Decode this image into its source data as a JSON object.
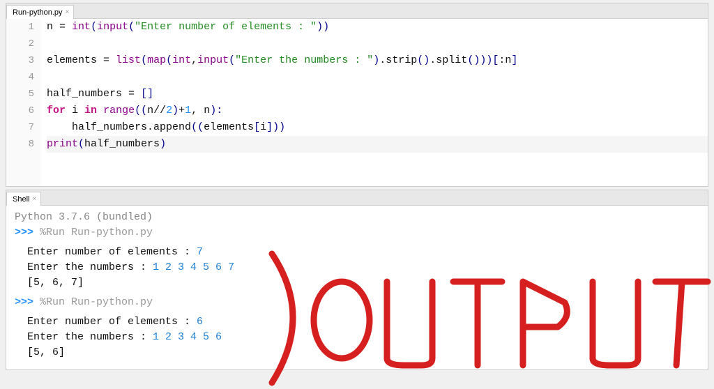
{
  "editor": {
    "tab": {
      "filename": "Run-python.py",
      "close": "×"
    },
    "lines": [
      {
        "n": 1,
        "tokens": [
          {
            "t": "n ",
            "c": "c-name"
          },
          {
            "t": "=",
            "c": "c-op"
          },
          {
            "t": " ",
            "c": ""
          },
          {
            "t": "int",
            "c": "c-builtin"
          },
          {
            "t": "(",
            "c": "c-paren"
          },
          {
            "t": "input",
            "c": "c-builtin"
          },
          {
            "t": "(",
            "c": "c-paren"
          },
          {
            "t": "\"Enter number of elements : \"",
            "c": "c-string"
          },
          {
            "t": "))",
            "c": "c-paren"
          }
        ]
      },
      {
        "n": 2,
        "tokens": []
      },
      {
        "n": 3,
        "tokens": [
          {
            "t": "elements ",
            "c": "c-name"
          },
          {
            "t": "=",
            "c": "c-op"
          },
          {
            "t": " ",
            "c": ""
          },
          {
            "t": "list",
            "c": "c-builtin"
          },
          {
            "t": "(",
            "c": "c-paren"
          },
          {
            "t": "map",
            "c": "c-builtin"
          },
          {
            "t": "(",
            "c": "c-paren"
          },
          {
            "t": "int",
            "c": "c-builtin"
          },
          {
            "t": ",",
            "c": "c-op"
          },
          {
            "t": "input",
            "c": "c-builtin"
          },
          {
            "t": "(",
            "c": "c-paren"
          },
          {
            "t": "\"Enter the numbers : \"",
            "c": "c-string"
          },
          {
            "t": ")",
            "c": "c-paren"
          },
          {
            "t": ".",
            "c": "c-op"
          },
          {
            "t": "strip",
            "c": "c-name"
          },
          {
            "t": "()",
            "c": "c-paren"
          },
          {
            "t": ".",
            "c": "c-op"
          },
          {
            "t": "split",
            "c": "c-name"
          },
          {
            "t": "()))[",
            "c": "c-paren"
          },
          {
            "t": ":",
            "c": "c-op"
          },
          {
            "t": "n",
            "c": "c-name"
          },
          {
            "t": "]",
            "c": "c-paren"
          }
        ]
      },
      {
        "n": 4,
        "tokens": []
      },
      {
        "n": 5,
        "tokens": [
          {
            "t": "half_numbers ",
            "c": "c-name"
          },
          {
            "t": "=",
            "c": "c-op"
          },
          {
            "t": " ",
            "c": ""
          },
          {
            "t": "[]",
            "c": "c-paren"
          }
        ]
      },
      {
        "n": 6,
        "tokens": [
          {
            "t": "for",
            "c": "c-keyword"
          },
          {
            "t": " i ",
            "c": "c-name"
          },
          {
            "t": "in",
            "c": "c-keyword"
          },
          {
            "t": " ",
            "c": ""
          },
          {
            "t": "range",
            "c": "c-builtin"
          },
          {
            "t": "((",
            "c": "c-paren"
          },
          {
            "t": "n",
            "c": "c-name"
          },
          {
            "t": "//",
            "c": "c-op"
          },
          {
            "t": "2",
            "c": "c-number"
          },
          {
            "t": ")",
            "c": "c-paren"
          },
          {
            "t": "+",
            "c": "c-op"
          },
          {
            "t": "1",
            "c": "c-number"
          },
          {
            "t": ", ",
            "c": "c-op"
          },
          {
            "t": "n",
            "c": "c-name"
          },
          {
            "t": "):",
            "c": "c-paren"
          }
        ]
      },
      {
        "n": 7,
        "tokens": [
          {
            "t": "    half_numbers",
            "c": "c-name"
          },
          {
            "t": ".",
            "c": "c-op"
          },
          {
            "t": "append",
            "c": "c-name"
          },
          {
            "t": "((",
            "c": "c-paren"
          },
          {
            "t": "elements",
            "c": "c-name"
          },
          {
            "t": "[",
            "c": "c-paren"
          },
          {
            "t": "i",
            "c": "c-name"
          },
          {
            "t": "]))",
            "c": "c-paren"
          }
        ]
      },
      {
        "n": 8,
        "highlighted": true,
        "tokens": [
          {
            "t": "print",
            "c": "c-builtin"
          },
          {
            "t": "(",
            "c": "c-paren"
          },
          {
            "t": "half_numbers",
            "c": "c-name"
          },
          {
            "t": ")",
            "c": "c-paren"
          }
        ]
      }
    ]
  },
  "shell": {
    "tab": {
      "label": "Shell",
      "close": "×"
    },
    "lines": [
      [
        {
          "t": "Python 3.7.6 (bundled)",
          "c": "sh-gray"
        }
      ],
      [
        {
          "t": ">>> ",
          "c": "sh-prompt"
        },
        {
          "t": "%Run Run-python.py",
          "c": "sh-cmd"
        }
      ],
      [],
      [
        {
          "t": "  Enter number of elements : ",
          "c": "sh-text"
        },
        {
          "t": "7",
          "c": "sh-num"
        }
      ],
      [
        {
          "t": "  Enter the numbers : ",
          "c": "sh-text"
        },
        {
          "t": "1 2 3 4 5 6 7",
          "c": "sh-num"
        }
      ],
      [
        {
          "t": "  [5, 6, 7]",
          "c": "sh-text"
        }
      ],
      [],
      [
        {
          "t": ">>> ",
          "c": "sh-prompt"
        },
        {
          "t": "%Run Run-python.py",
          "c": "sh-cmd"
        }
      ],
      [],
      [
        {
          "t": "  Enter number of elements : ",
          "c": "sh-text"
        },
        {
          "t": "6",
          "c": "sh-num"
        }
      ],
      [
        {
          "t": "  Enter the numbers : ",
          "c": "sh-text"
        },
        {
          "t": "1 2 3 4 5 6",
          "c": "sh-num"
        }
      ],
      [
        {
          "t": "  [5, 6]",
          "c": "sh-text"
        }
      ]
    ]
  },
  "annotation": {
    "label": "OUTPUT",
    "color": "#d62020"
  }
}
